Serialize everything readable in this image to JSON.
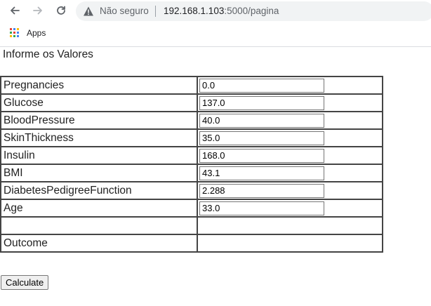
{
  "browser": {
    "security_label": "Não seguro",
    "url_host": "192.168.1.103",
    "url_rest": ":5000/pagina",
    "bookmarks": [
      {
        "label": "Apps",
        "icon": "apps-grid-icon"
      }
    ],
    "apps_colors": [
      "#ea4335",
      "#4285f4",
      "#fbbc05",
      "#34a853",
      "#ea4335",
      "#4285f4",
      "#fbbc05",
      "#34a853",
      "#4285f4"
    ]
  },
  "page": {
    "heading": "Informe os Valores",
    "rows": [
      {
        "label": "Pregnancies",
        "value": "0.0"
      },
      {
        "label": "Glucose",
        "value": "137.0"
      },
      {
        "label": "BloodPressure",
        "value": "40.0"
      },
      {
        "label": "SkinThickness",
        "value": "35.0"
      },
      {
        "label": "Insulin",
        "value": "168.0"
      },
      {
        "label": "BMI",
        "value": "43.1"
      },
      {
        "label": "DiabetesPedigreeFunction",
        "value": "2.288"
      },
      {
        "label": "Age",
        "value": "33.0"
      }
    ],
    "outcome_label": "Outcome",
    "outcome_value": "",
    "calculate_label": "Calculate"
  }
}
